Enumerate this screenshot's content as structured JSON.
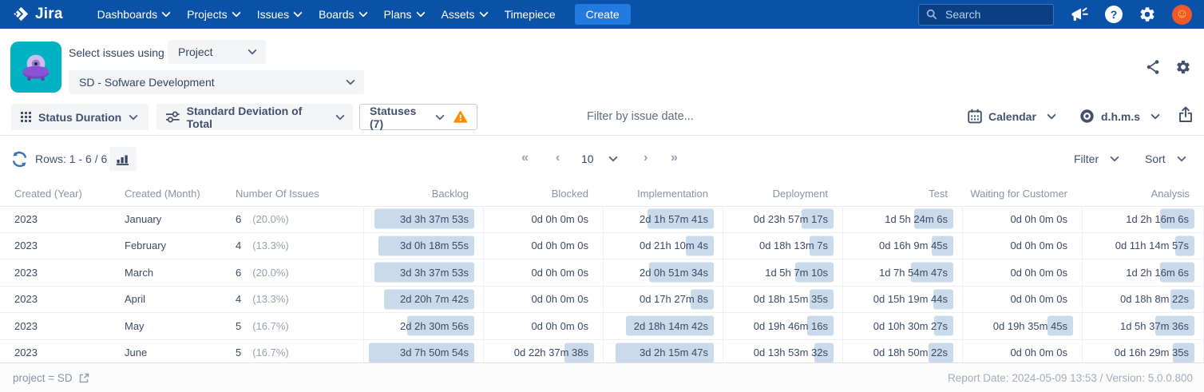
{
  "navbar": {
    "logo_text": "Jira",
    "items": [
      {
        "label": "Dashboards",
        "chevron": true
      },
      {
        "label": "Projects",
        "chevron": true
      },
      {
        "label": "Issues",
        "chevron": true
      },
      {
        "label": "Boards",
        "chevron": true
      },
      {
        "label": "Plans",
        "chevron": true
      },
      {
        "label": "Assets",
        "chevron": true
      },
      {
        "label": "Timepiece",
        "chevron": false
      }
    ],
    "create_label": "Create",
    "search_placeholder": "Search"
  },
  "header": {
    "select_issues_label": "Select issues using",
    "mode_value": "Project",
    "project_value": "SD - Sofware Development"
  },
  "toolbar": {
    "report_type_label": "Status Duration",
    "metric_label": "Standard Deviation of Total",
    "statuses_label": "Statuses (7)",
    "date_filter_placeholder": "Filter by issue date...",
    "calendar_label": "Calendar",
    "time_format_label": "d.h.m.s"
  },
  "pagination": {
    "rows_label": "Rows: 1 - 6 / 6",
    "first_symbol": "«",
    "prev_symbol": "‹",
    "page_size": "10",
    "next_symbol": "›",
    "last_symbol": "»"
  },
  "controls": {
    "filter_label": "Filter",
    "sort_label": "Sort"
  },
  "table": {
    "columns": [
      "Created (Year)",
      "Created (Month)",
      "Number Of Issues",
      "Backlog",
      "Blocked",
      "Implementation",
      "Deployment",
      "Test",
      "Waiting for Customer",
      "Analysis"
    ],
    "rows": [
      {
        "year": "2023",
        "month": "January",
        "issues": "6",
        "pct": "(20.0%)",
        "durations": [
          "3d 3h 37m 53s",
          "0d 0h 0m 0s",
          "2d 1h 57m 41s",
          "0d 23h 57m 17s",
          "1d 5h 24m 6s",
          "0d 0h 0m 0s",
          "1d 2h 16m 6s"
        ]
      },
      {
        "year": "2023",
        "month": "February",
        "issues": "4",
        "pct": "(13.3%)",
        "durations": [
          "3d 0h 18m 55s",
          "0d 0h 0m 0s",
          "0d 21h 10m 4s",
          "0d 18h 13m 7s",
          "0d 16h 9m 45s",
          "0d 0h 0m 0s",
          "0d 11h 14m 57s"
        ]
      },
      {
        "year": "2023",
        "month": "March",
        "issues": "6",
        "pct": "(20.0%)",
        "durations": [
          "3d 3h 37m 53s",
          "0d 0h 0m 0s",
          "2d 0h 51m 34s",
          "1d 5h 7m 10s",
          "1d 7h 54m 47s",
          "0d 0h 0m 0s",
          "1d 2h 16m 6s"
        ]
      },
      {
        "year": "2023",
        "month": "April",
        "issues": "4",
        "pct": "(13.3%)",
        "durations": [
          "2d 20h 7m 42s",
          "0d 0h 0m 0s",
          "0d 17h 27m 8s",
          "0d 18h 15m 35s",
          "0d 15h 19m 44s",
          "0d 0h 0m 0s",
          "0d 18h 8m 22s"
        ]
      },
      {
        "year": "2023",
        "month": "May",
        "issues": "5",
        "pct": "(16.7%)",
        "durations": [
          "2d 2h 30m 56s",
          "0d 0h 0m 0s",
          "2d 18h 14m 42s",
          "0d 19h 46m 16s",
          "0d 10h 30m 27s",
          "0d 19h 35m 45s",
          "1d 5h 37m 36s"
        ]
      },
      {
        "year": "2023",
        "month": "June",
        "issues": "5",
        "pct": "(16.7%)",
        "durations": [
          "3d 7h 50m 54s",
          "0d 22h 37m 38s",
          "3d 2h 15m 47s",
          "0d 13h 53m 32s",
          "0d 18h 50m 22s",
          "0d 0h 0m 0s",
          "0d 16h 29m 35s"
        ]
      }
    ]
  },
  "footer": {
    "jql": "project = SD",
    "report_info": "Report Date: 2024-05-09 13:53 / Version: 5.0.0.800"
  },
  "colors": {
    "navbar_blue": "#0A51A8",
    "create_button_blue": "#2279DF",
    "duration_bar_fill": "#C9DAEB",
    "warning_orange": "#FC8B00",
    "app_icon_teal": "#00B3C4",
    "avatar_orange": "#F05A2B"
  }
}
